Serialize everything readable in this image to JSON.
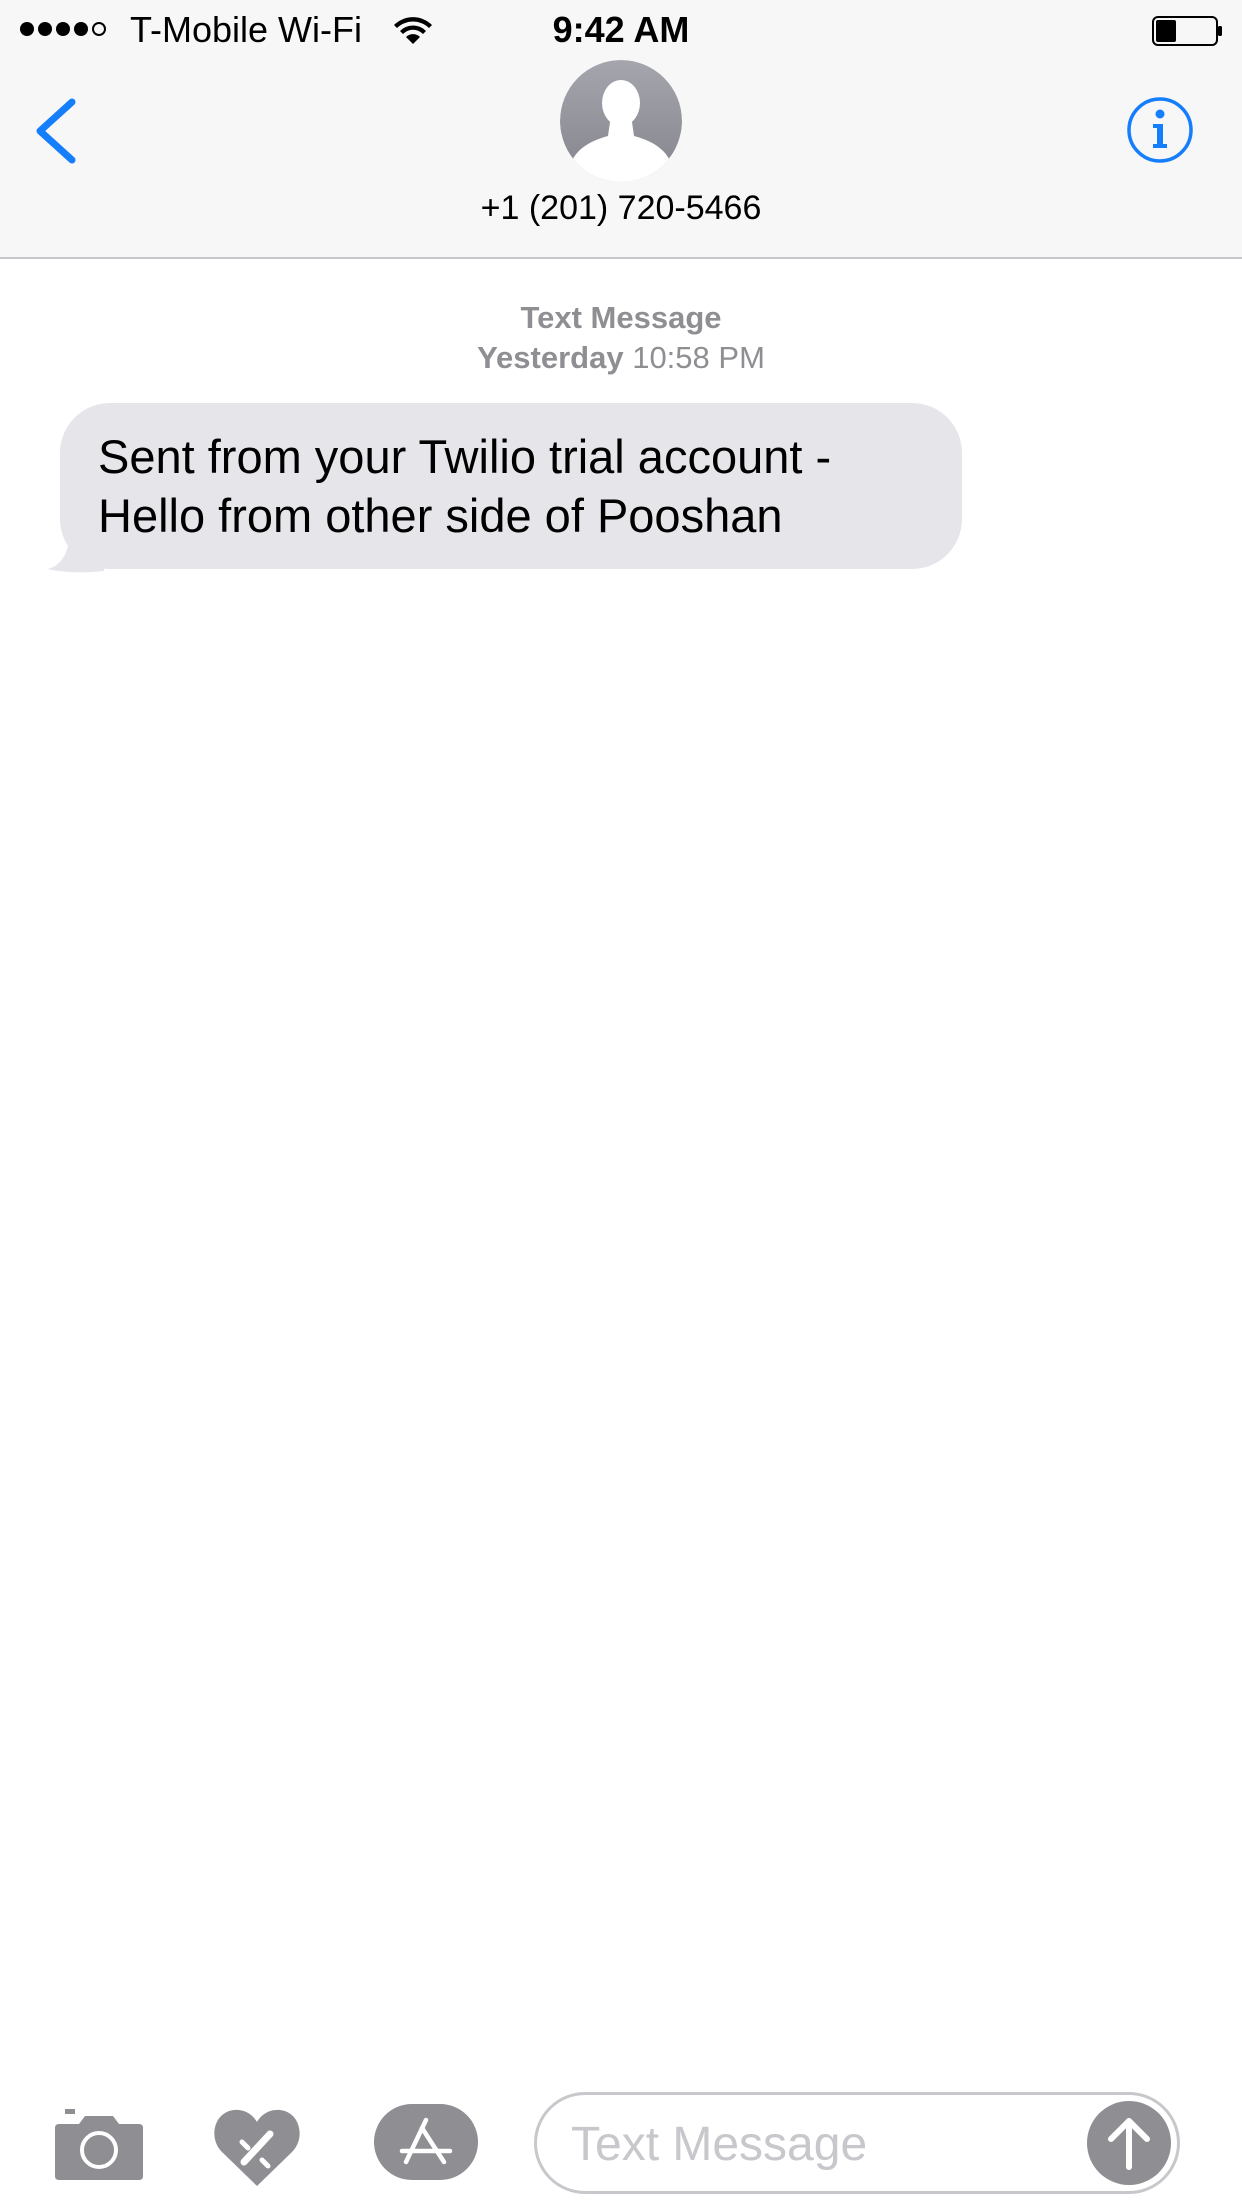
{
  "status_bar": {
    "signal_bars_filled": 4,
    "signal_bars_total": 5,
    "carrier": "T-Mobile Wi-Fi",
    "time": "9:42 AM",
    "battery_level_fraction": 0.35,
    "icons": [
      "wifi-icon",
      "battery-icon"
    ]
  },
  "nav": {
    "back_icon": "chevron-left-icon",
    "contact_number": "+1 (201) 720-5466",
    "avatar_icon": "person-silhouette-icon",
    "info_icon": "info-icon"
  },
  "conversation": {
    "service_label": "Text Message",
    "day": "Yesterday",
    "time": "10:58 PM",
    "messages": [
      {
        "direction": "incoming",
        "lines": [
          "Sent from your Twilio trial account -",
          "Hello from other side of Pooshan"
        ]
      }
    ]
  },
  "input_bar": {
    "placeholder": "Text Message",
    "value": "",
    "tools": [
      "camera-icon",
      "digital-touch-icon",
      "app-store-icon"
    ],
    "send_icon": "arrow-up-icon"
  },
  "colors": {
    "accent": "#147efb",
    "header_bg": "#f7f7f7",
    "bubble_incoming": "#e5e5ea",
    "meta_text": "#8e8e93",
    "tool_gray": "#8e8e93"
  }
}
